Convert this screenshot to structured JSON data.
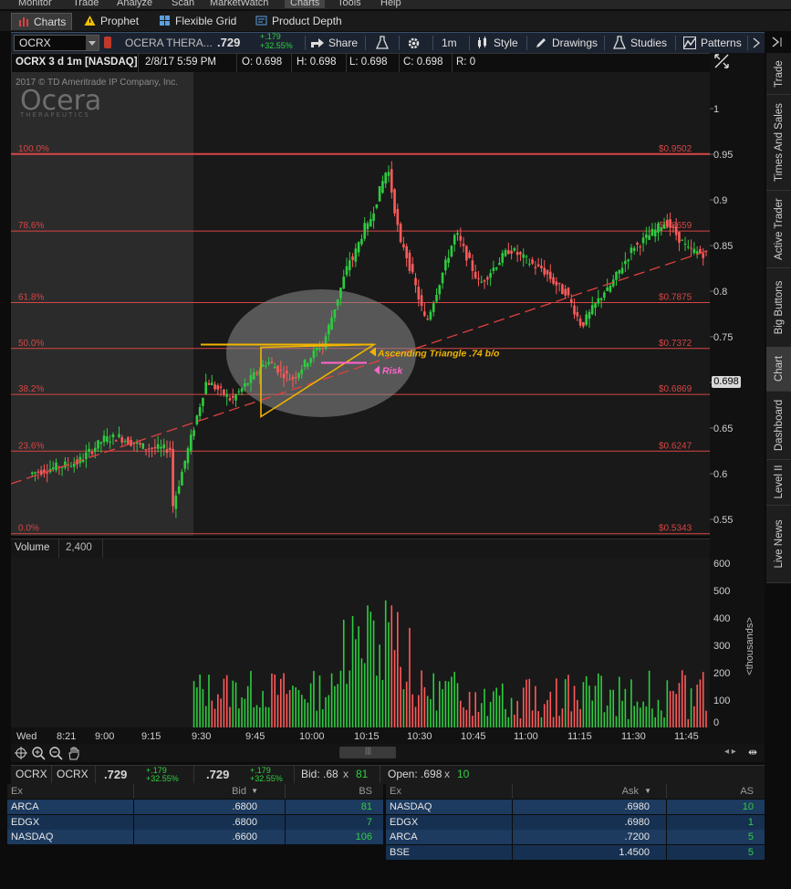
{
  "top_menu": [
    "Monitor",
    "Trade",
    "Analyze",
    "Scan",
    "MarketWatch",
    "Charts",
    "Tools",
    "Help"
  ],
  "subtabs": [
    {
      "label": "Charts",
      "icon": "bar-chart-icon",
      "active": true
    },
    {
      "label": "Prophet",
      "icon": "warning-triangle-icon",
      "active": false
    },
    {
      "label": "Flexible Grid",
      "icon": "grid-icon",
      "active": false
    },
    {
      "label": "Product Depth",
      "icon": "depth-icon",
      "active": false
    }
  ],
  "toolbar": {
    "symbol": "OCRX",
    "company": "OCERA THERA...",
    "last": ".729",
    "change": "+.179",
    "change_pct": "+32.55%",
    "share": "Share",
    "interval": "1m",
    "style": "Style",
    "drawings": "Drawings",
    "studies": "Studies",
    "patterns": "Patterns"
  },
  "chart_header": {
    "title": "OCRX 3 d 1m [NASDAQ]",
    "datetime": "2/8/17 5:59 PM",
    "open": "O:  0.698",
    "high": "H:  0.698",
    "low": "L:  0.698",
    "close": "C:  0.698",
    "range": "R:  0"
  },
  "watermark": {
    "copyright": "2017 © TD Ameritrade IP Company, Inc.",
    "logo": "Ocera",
    "logo_sub": "THERAPEUTICS"
  },
  "chart_data": {
    "type": "candlestick",
    "price_axis": {
      "min": 0.55,
      "max": 1.0,
      "ticks": [
        "1",
        "0.95",
        "0.9",
        "0.85",
        "0.8",
        "0.75",
        "0.7",
        "0.65",
        "0.6",
        "0.55"
      ]
    },
    "current_price": "0.698",
    "time_ticks": [
      "Wed",
      "8:21",
      "9:00",
      "9:15",
      "9:30",
      "9:45",
      "10:00",
      "10:15",
      "10:30",
      "10:45",
      "11:00",
      "11:15",
      "11:30",
      "11:45"
    ],
    "fib_levels": [
      {
        "pct": "100.0%",
        "price": "$0.9502",
        "value": 0.9502
      },
      {
        "pct": "78.6%",
        "price": "$0.8659",
        "value": 0.8659
      },
      {
        "pct": "61.8%",
        "price": "$0.7875",
        "value": 0.7875
      },
      {
        "pct": "50.0%",
        "price": "$0.7372",
        "value": 0.7372
      },
      {
        "pct": "38.2%",
        "price": "$0.6869",
        "value": 0.6869
      },
      {
        "pct": "23.6%",
        "price": "$0.6247",
        "value": 0.6247
      },
      {
        "pct": "0.0%",
        "price": "$0.5343",
        "value": 0.5343
      }
    ],
    "annotations": {
      "pattern": "Ascending Triangle .74 b/o",
      "risk": "Risk"
    },
    "volume": {
      "label": "Volume",
      "value": "2,400",
      "unit": "<thousands>",
      "ticks": [
        "600",
        "500",
        "400",
        "300",
        "200",
        "100",
        "0"
      ],
      "max": 600
    }
  },
  "sidebar": [
    "Trade",
    "Times And Sales",
    "Active Trader",
    "Big Buttons",
    "Chart",
    "Dashboard",
    "Level II",
    "Live News"
  ],
  "level2": {
    "symbol": "OCRX",
    "symbol2": "OCRX",
    "last": ".729",
    "change": "+.179",
    "change_pct": "+32.55%",
    "last2": ".729",
    "change2": "+.179",
    "change_pct2": "+32.55%",
    "bid_label": "Bid: .68",
    "bid_size": "81",
    "open_label": "Open: .698",
    "open_size": "10",
    "bid_headers": [
      "Ex",
      "Bid",
      "BS"
    ],
    "bids": [
      [
        "ARCA",
        ".6800",
        "81"
      ],
      [
        "EDGX",
        ".6800",
        "7"
      ],
      [
        "NASDAQ",
        ".6600",
        "106"
      ]
    ],
    "ask_headers": [
      "Ex",
      "Ask",
      "AS"
    ],
    "asks": [
      [
        "NASDAQ",
        ".6980",
        "10"
      ],
      [
        "EDGX",
        ".6980",
        "1"
      ],
      [
        "ARCA",
        ".7200",
        "5"
      ],
      [
        "BSE",
        "1.4500",
        "5"
      ]
    ]
  },
  "colors": {
    "fib_line": "#d94545",
    "up": "#2ecc40",
    "down": "#ff5a5a",
    "trend": "#e24040",
    "triangle": "#f0b400",
    "risk": "#ff66cc"
  }
}
